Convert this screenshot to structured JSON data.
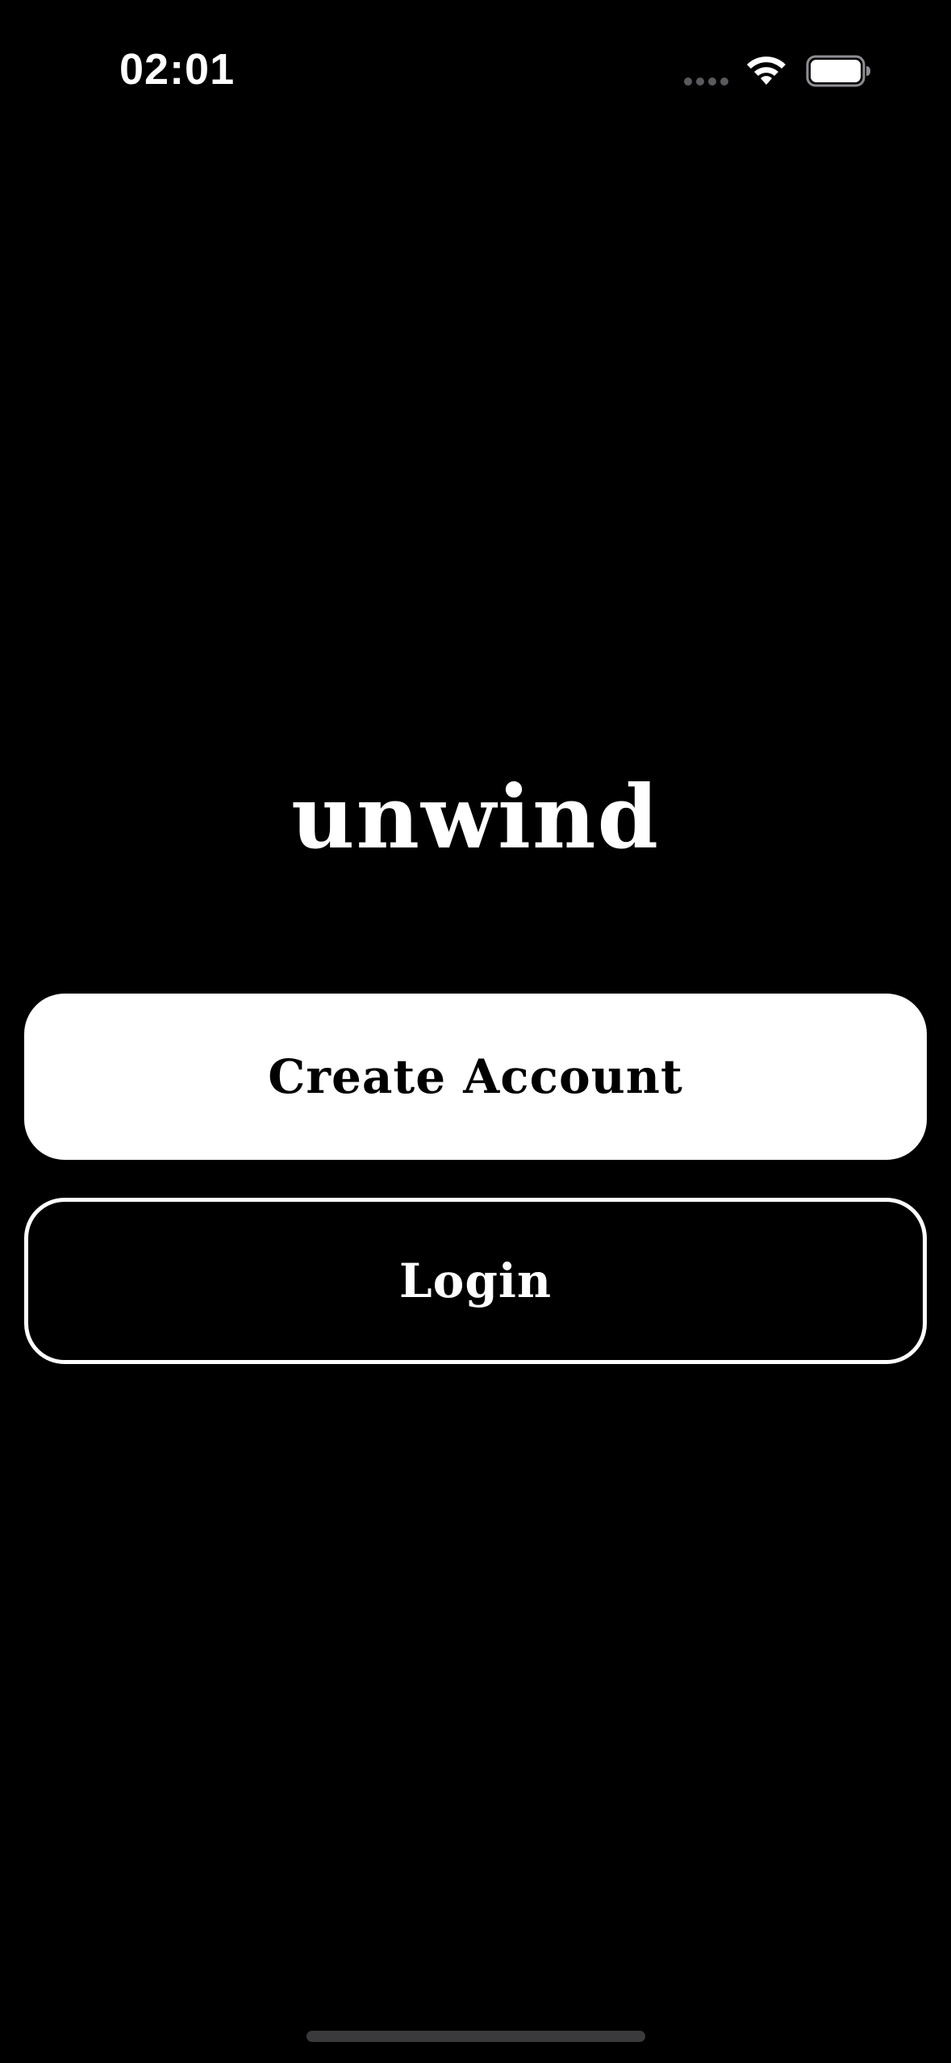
{
  "status_bar": {
    "time": "02:01",
    "icons": [
      "cellular-signal-icon",
      "wifi-icon",
      "battery-icon"
    ],
    "battery_level_percent": 100
  },
  "brand": {
    "name": "unwind"
  },
  "actions": {
    "create_account_label": "Create Account",
    "login_label": "Login"
  },
  "colors": {
    "background": "#000000",
    "primary_button_bg": "#ffffff",
    "primary_button_text": "#000000",
    "secondary_button_border": "#ffffff",
    "secondary_button_text": "#ffffff"
  }
}
